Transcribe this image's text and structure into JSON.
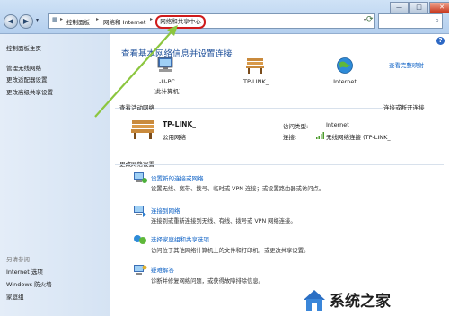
{
  "address_bar": {
    "crumbs": [
      "控制面板",
      "网络和 Internet",
      "网络和共享中心"
    ]
  },
  "window_buttons": {
    "minimize": "—",
    "maximize": "□",
    "close": "✕"
  },
  "sidebar": {
    "items": [
      {
        "label": "控制面板主页"
      },
      {
        "label": "管理无线网络"
      },
      {
        "label": "更改适配器设置"
      },
      {
        "label": "更改高级共享设置"
      }
    ],
    "see_also_heading": "另请参阅",
    "see_also": [
      {
        "label": "Internet 选项"
      },
      {
        "label": "Windows 防火墙"
      },
      {
        "label": "家庭组"
      }
    ]
  },
  "main": {
    "title": "查看基本网络信息并设置连接",
    "full_map_link": "查看完整映射",
    "map": {
      "computer_name": "-U-PC",
      "computer_note": "(此计算机)",
      "router_name": "TP-LINK_",
      "internet_label": "Internet"
    },
    "active_networks": {
      "heading": "查看活动网络",
      "connect_link": "连接或断开连接",
      "network_name": "TP-LINK_",
      "network_type": "公用网络",
      "access_type_label": "访问类型:",
      "access_type_value": "Internet",
      "connection_label": "连接:",
      "connection_value": "无线网络连接 (TP-LINK_"
    },
    "change_settings": {
      "heading": "更改网络设置",
      "tasks": [
        {
          "title": "设置新的连接或网络",
          "desc": "设置无线、宽带、拨号、临时或 VPN 连接；或设置路由器或访问点。"
        },
        {
          "title": "连接到网络",
          "desc": "连接到或重新连接到无线、有线、拨号或 VPN 网络连接。"
        },
        {
          "title": "选择家庭组和共享选项",
          "desc": "访问位于其他网络计算机上的文件和打印机，或更改共享设置。"
        },
        {
          "title": "疑难解答",
          "desc": "诊断并修复网络问题，或获得故障排除信息。"
        }
      ]
    }
  },
  "watermark": {
    "text": "系统之家"
  },
  "colors": {
    "link": "#0a5fc4",
    "title": "#1d4f9a",
    "annotation": "#cf1b1b",
    "arrow": "#8cc63f"
  }
}
